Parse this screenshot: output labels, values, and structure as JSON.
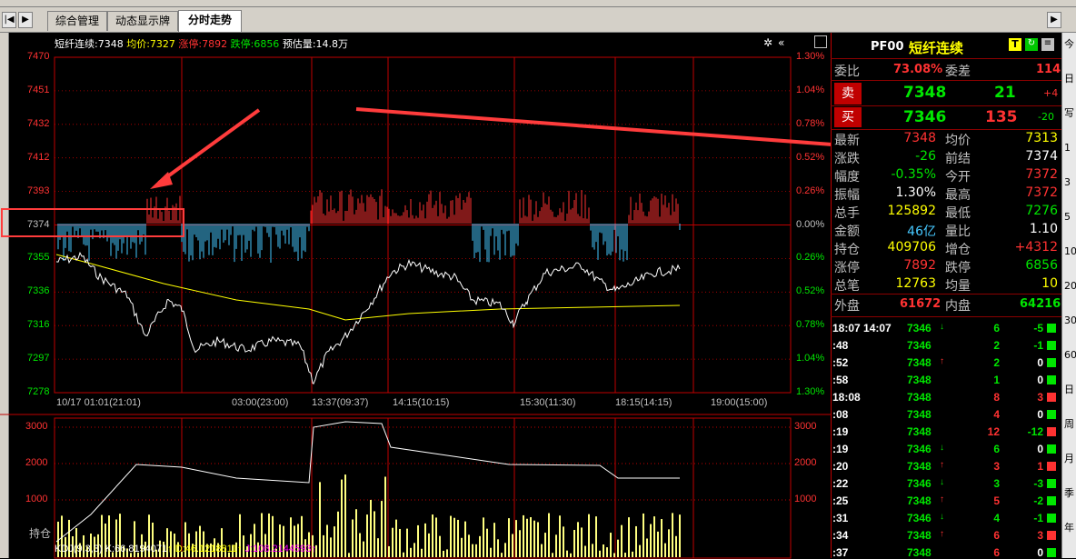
{
  "tabs": [
    "综合管理",
    "动态显示牌",
    "分时走势"
  ],
  "nav": {
    "first": "|◀",
    "next": "▶"
  },
  "info": {
    "name": "短纤连续",
    "price_lbl": ":7348",
    "avg_lbl": "均价",
    "avg": ":7327",
    "up_lbl": "涨停",
    "up": ":7892",
    "down_lbl": "跌停",
    "down": ":6856",
    "vol_lbl": "预估量",
    "vol": ":14.8万"
  },
  "price_axis": [
    "7470",
    "7451",
    "7432",
    "7412",
    "7393",
    "7374",
    "7355",
    "7336",
    "7316",
    "7297",
    "7278"
  ],
  "pct_axis": [
    "1.30%",
    "1.04%",
    "0.78%",
    "0.52%",
    "0.26%",
    "0.00%",
    "0.26%",
    "0.52%",
    "0.78%",
    "1.04%",
    "1.30%"
  ],
  "time_axis": [
    "10/17 01:01(21:01)",
    "03:00(23:00)",
    "13:37(09:37)",
    "14:15(10:15)",
    "15:30(11:30)",
    "18:15(14:15)",
    "19:00(15:00)"
  ],
  "vol_axis": [
    "3000",
    "2000",
    "1000"
  ],
  "vol_label": "持仓",
  "kdj": {
    "name": "KDJ(9,3,3)",
    "k": "K:66.8194071",
    "d": "D:46.1218811",
    "j": "J:108.2144593"
  },
  "panel": {
    "code": "PF00",
    "name": "短纤连续",
    "t": "T",
    "wb_lbl": "委比",
    "wb": "73.08%",
    "wc_lbl": "委差",
    "wc": "114",
    "sell_lbl": "卖",
    "sell_p": "7348",
    "sell_v": "21",
    "sell_c": "+4",
    "buy_lbl": "买",
    "buy_p": "7346",
    "buy_v": "135",
    "buy_c": "-20",
    "rows": [
      [
        "最新",
        "7348",
        "均价",
        "7313"
      ],
      [
        "涨跌",
        "-26",
        "前结",
        "7374"
      ],
      [
        "幅度",
        "-0.35%",
        "今开",
        "7372"
      ],
      [
        "振幅",
        "1.30%",
        "最高",
        "7372"
      ],
      [
        "总手",
        "125892",
        "最低",
        "7276"
      ],
      [
        "金额",
        "46亿",
        "量比",
        "1.10"
      ],
      [
        "持仓",
        "409706",
        "增仓",
        "+4312"
      ],
      [
        "涨停",
        "7892",
        "跌停",
        "6856"
      ],
      [
        "总笔",
        "12763",
        "均量",
        "10"
      ]
    ],
    "outer_lbl": "外盘",
    "outer": "61672",
    "inner_lbl": "内盘",
    "inner": "64216"
  },
  "ticks": [
    [
      "18:07 14:07",
      "7346",
      "↓",
      "6",
      "-5"
    ],
    [
      ":48",
      "7346",
      "",
      "2",
      "-1"
    ],
    [
      ":52",
      "7348",
      "↑",
      "2",
      "0"
    ],
    [
      ":58",
      "7348",
      "",
      "1",
      "0"
    ],
    [
      "18:08",
      "7348",
      "",
      "8",
      "3"
    ],
    [
      ":08",
      "7348",
      "",
      "4",
      "0"
    ],
    [
      ":19",
      "7348",
      "",
      "12",
      "-12"
    ],
    [
      ":19",
      "7346",
      "↓",
      "6",
      "0"
    ],
    [
      ":20",
      "7348",
      "↑",
      "3",
      "1"
    ],
    [
      ":22",
      "7346",
      "↓",
      "3",
      "-3"
    ],
    [
      ":25",
      "7348",
      "↑",
      "5",
      "-2"
    ],
    [
      ":31",
      "7346",
      "↓",
      "4",
      "-1"
    ],
    [
      ":34",
      "7348",
      "↑",
      "6",
      "3"
    ],
    [
      ":37",
      "7348",
      "",
      "6",
      "0"
    ]
  ],
  "right_strip": [
    "今",
    "日",
    "写",
    "1",
    "3",
    "5",
    "10",
    "20",
    "30",
    "60",
    "日",
    "周",
    "月",
    "季",
    "年"
  ],
  "colors": {
    "grid": "#c00000",
    "up": "#ff3232",
    "down": "#46c8ff",
    "avg": "#ffff00",
    "price": "#ffffff",
    "annot": "#ff3c3c"
  }
}
